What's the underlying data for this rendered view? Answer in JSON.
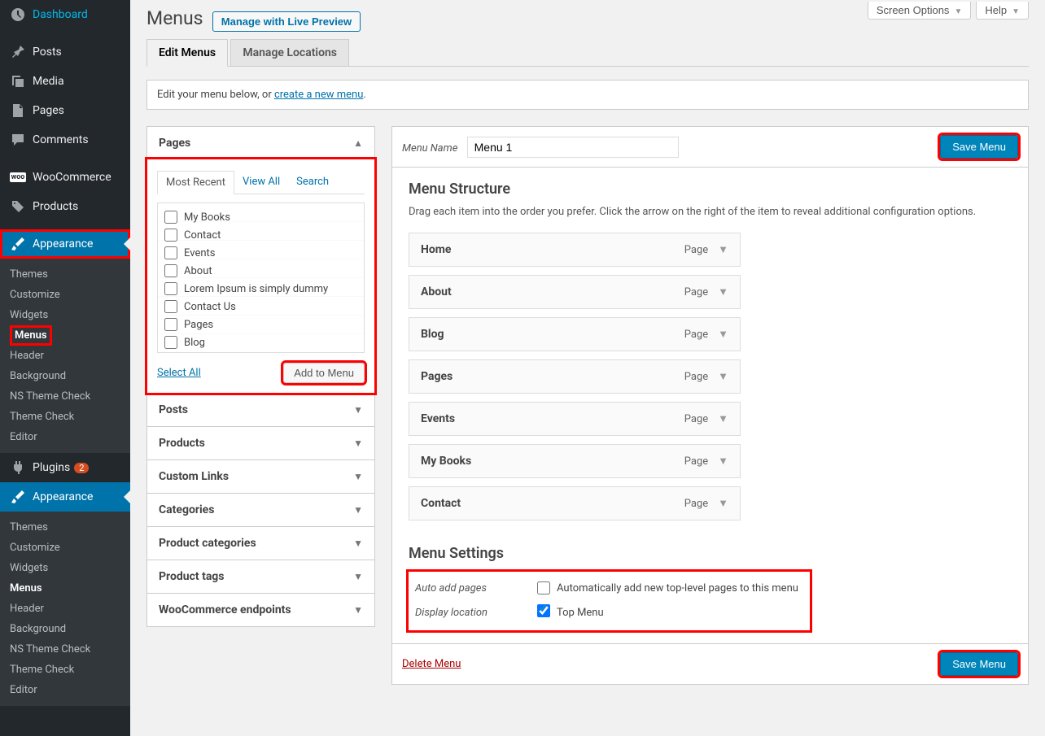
{
  "top_right": {
    "screen_options": "Screen Options",
    "help": "Help"
  },
  "page": {
    "title": "Menus",
    "live_preview_btn": "Manage with Live Preview",
    "tabs": {
      "edit": "Edit Menus",
      "locations": "Manage Locations"
    },
    "notice_prefix": "Edit your menu below, or ",
    "notice_link": "create a new menu",
    "notice_suffix": "."
  },
  "sidebar": {
    "dashboard": "Dashboard",
    "posts": "Posts",
    "media": "Media",
    "pages": "Pages",
    "comments": "Comments",
    "woocommerce": "WooCommerce",
    "products": "Products",
    "appearance": "Appearance",
    "plugins": "Plugins",
    "plugins_badge": "2",
    "appearance2": "Appearance",
    "sub": {
      "themes": "Themes",
      "customize": "Customize",
      "widgets": "Widgets",
      "menus": "Menus",
      "header": "Header",
      "background": "Background",
      "ns_theme_check": "NS Theme Check",
      "theme_check": "Theme Check",
      "editor": "Editor"
    }
  },
  "pages_panel": {
    "title": "Pages",
    "tabs": {
      "recent": "Most Recent",
      "view_all": "View All",
      "search": "Search"
    },
    "items": [
      "My Books",
      "Contact",
      "Events",
      "About",
      "Lorem Ipsum is simply dummy",
      "Contact Us",
      "Pages",
      "Blog"
    ],
    "select_all": "Select All",
    "add_to_menu": "Add to Menu"
  },
  "accordions": {
    "posts": "Posts",
    "products": "Products",
    "custom_links": "Custom Links",
    "categories": "Categories",
    "product_categories": "Product categories",
    "product_tags": "Product tags",
    "woo_endpoints": "WooCommerce endpoints"
  },
  "menu_edit": {
    "menu_name_label": "Menu Name",
    "menu_name_value": "Menu 1",
    "save_menu": "Save Menu",
    "structure_title": "Menu Structure",
    "structure_help": "Drag each item into the order you prefer. Click the arrow on the right of the item to reveal additional configuration options.",
    "items": [
      {
        "title": "Home",
        "type": "Page"
      },
      {
        "title": "About",
        "type": "Page"
      },
      {
        "title": "Blog",
        "type": "Page"
      },
      {
        "title": "Pages",
        "type": "Page"
      },
      {
        "title": "Events",
        "type": "Page"
      },
      {
        "title": "My Books",
        "type": "Page"
      },
      {
        "title": "Contact",
        "type": "Page"
      }
    ],
    "settings_title": "Menu Settings",
    "auto_add_label": "Auto add pages",
    "auto_add_cb": "Automatically add new top-level pages to this menu",
    "display_loc_label": "Display location",
    "display_loc_cb": "Top Menu",
    "delete_menu": "Delete Menu"
  }
}
